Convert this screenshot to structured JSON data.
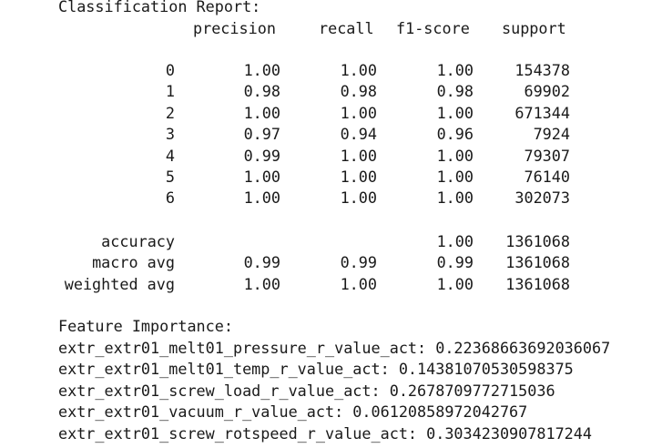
{
  "report": {
    "title": "Classification Report:",
    "headers": {
      "precision": "precision",
      "recall": "recall",
      "f1": "f1-score",
      "support": "support"
    },
    "rows": [
      {
        "label": "0",
        "precision": "1.00",
        "recall": "1.00",
        "f1": "1.00",
        "support": "154378"
      },
      {
        "label": "1",
        "precision": "0.98",
        "recall": "0.98",
        "f1": "0.98",
        "support": "69902"
      },
      {
        "label": "2",
        "precision": "1.00",
        "recall": "1.00",
        "f1": "1.00",
        "support": "671344"
      },
      {
        "label": "3",
        "precision": "0.97",
        "recall": "0.94",
        "f1": "0.96",
        "support": "7924"
      },
      {
        "label": "4",
        "precision": "0.99",
        "recall": "1.00",
        "f1": "1.00",
        "support": "79307"
      },
      {
        "label": "5",
        "precision": "1.00",
        "recall": "1.00",
        "f1": "1.00",
        "support": "76140"
      },
      {
        "label": "6",
        "precision": "1.00",
        "recall": "1.00",
        "f1": "1.00",
        "support": "302073"
      }
    ],
    "summary": [
      {
        "label": "accuracy",
        "precision": "",
        "recall": "",
        "f1": "1.00",
        "support": "1361068"
      },
      {
        "label": "macro avg",
        "precision": "0.99",
        "recall": "0.99",
        "f1": "0.99",
        "support": "1361068"
      },
      {
        "label": "weighted avg",
        "precision": "1.00",
        "recall": "1.00",
        "f1": "1.00",
        "support": "1361068"
      }
    ]
  },
  "features": {
    "title": "Feature Importance:",
    "items": [
      "extr_extr01_melt01_pressure_r_value_act: 0.22368663692036067",
      "extr_extr01_melt01_temp_r_value_act: 0.14381070530598375",
      "extr_extr01_screw_load_r_value_act: 0.2678709772715036",
      "extr_extr01_vacuum_r_value_act: 0.06120858972042767",
      "extr_extr01_screw_rotspeed_r_value_act: 0.3034230907817244"
    ]
  }
}
